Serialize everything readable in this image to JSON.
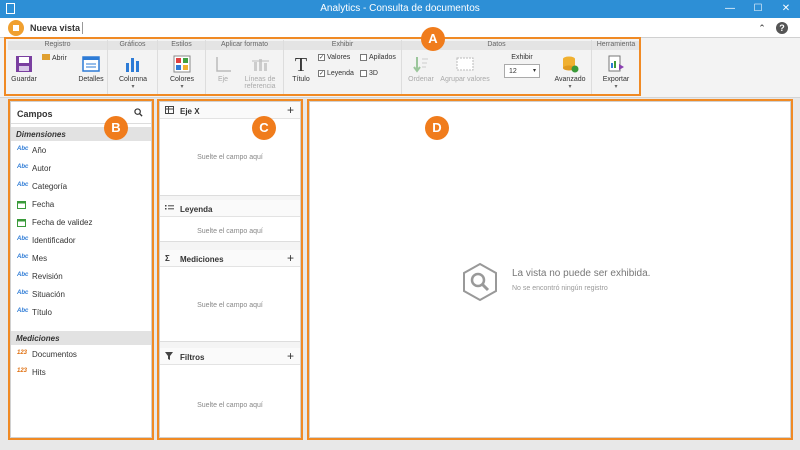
{
  "window": {
    "title": "Analytics - Consulta de documentos",
    "minimize": "—",
    "maximize": "☐",
    "close": "✕"
  },
  "tab": {
    "name": "Nueva vista",
    "collapse": "⌃",
    "help": "?"
  },
  "ribbon": {
    "registro": {
      "title": "Registro",
      "guardar": "Guardar",
      "abrir": "Abrir",
      "detalles": "Detalles"
    },
    "graficos": {
      "title": "Gráficos",
      "columna": "Columna"
    },
    "estilos": {
      "title": "Estilos",
      "colores": "Colores"
    },
    "formato": {
      "title": "Aplicar formato",
      "eje": "Eje",
      "lineas": "Líneas de referencia"
    },
    "exhibir": {
      "title": "Exhibir",
      "titulo": "Título",
      "valores": "Valores",
      "apilados": "Apilados",
      "leyenda": "Leyenda",
      "tresd": "3D"
    },
    "datos": {
      "title": "Datos",
      "ordenar": "Ordenar",
      "agrupar": "Agrupar valores",
      "exhibir_label": "Exhibir",
      "exhibir_value": "12",
      "avanzado": "Avanzado"
    },
    "herramienta": {
      "title": "Herramienta",
      "exportar": "Exportar"
    },
    "dropdown_glyph": "▾",
    "check_glyph": "✓"
  },
  "campos": {
    "title": "Campos",
    "dimensiones_title": "Dimensiones",
    "dimensiones": [
      {
        "label": "Año",
        "type": "Abc"
      },
      {
        "label": "Autor",
        "type": "Abc"
      },
      {
        "label": "Categoría",
        "type": "Abc"
      },
      {
        "label": "Fecha",
        "type": "date"
      },
      {
        "label": "Fecha de validez",
        "type": "date"
      },
      {
        "label": "Identificador",
        "type": "Abc"
      },
      {
        "label": "Mes",
        "type": "Abc"
      },
      {
        "label": "Revisión",
        "type": "Abc"
      },
      {
        "label": "Situación",
        "type": "Abc"
      },
      {
        "label": "Título",
        "type": "Abc"
      }
    ],
    "mediciones_title": "Mediciones",
    "mediciones": [
      {
        "label": "Documentos",
        "type": "123"
      },
      {
        "label": "Hits",
        "type": "123"
      }
    ]
  },
  "zones": {
    "ejex": {
      "title": "Eje X",
      "hint": "Suelte el campo aquí"
    },
    "leyenda": {
      "title": "Leyenda",
      "hint": "Suelte el campo aquí"
    },
    "mediciones": {
      "title": "Mediciones",
      "hint": "Suelte el campo aquí"
    },
    "filtros": {
      "title": "Filtros",
      "hint": "Suelte el campo aquí"
    },
    "add_glyph": "+"
  },
  "view": {
    "message": "La vista no puede ser exhibida.",
    "sub": "No se encontró ningún registro"
  },
  "callouts": {
    "a": "A",
    "b": "B",
    "c": "C",
    "d": "D"
  },
  "colors": {
    "titlebar": "#2d8fd6",
    "accent": "#f07c1c",
    "highlight": "#f08a24"
  }
}
